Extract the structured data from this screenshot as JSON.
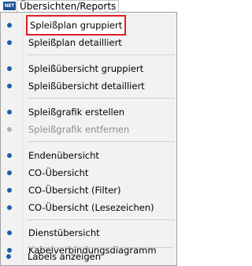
{
  "menubar": {
    "app_icon_text": "NET",
    "menu_title": "Übersichten/Reports"
  },
  "colors": {
    "bullet": "#1c5fad",
    "highlight_border": "#e01f26",
    "menu_background": "#f2f2f2"
  },
  "menu": {
    "items": [
      {
        "label": "Spleißplan gruppiert",
        "enabled": true,
        "highlighted": true
      },
      {
        "label": "Spleißplan detailliert",
        "enabled": true
      },
      {
        "label": "Spleißübersicht gruppiert",
        "enabled": true
      },
      {
        "label": "Spleißübersicht detailliert",
        "enabled": true
      },
      {
        "label": "Spleißgrafik erstellen",
        "enabled": true
      },
      {
        "label": "Spleißgrafik entfernen",
        "enabled": false
      },
      {
        "label": "Endenübersicht",
        "enabled": true
      },
      {
        "label": "CO-Übersicht",
        "enabled": true
      },
      {
        "label": "CO-Übersicht (Filter)",
        "enabled": true
      },
      {
        "label": "CO-Übersicht (Lesezeichen)",
        "enabled": true
      },
      {
        "label": "Dienstübersicht",
        "enabled": true
      },
      {
        "label": "Kabelverbindungsdiagramm",
        "enabled": true
      },
      {
        "label": "Labels anzeigen",
        "enabled": true
      }
    ]
  }
}
